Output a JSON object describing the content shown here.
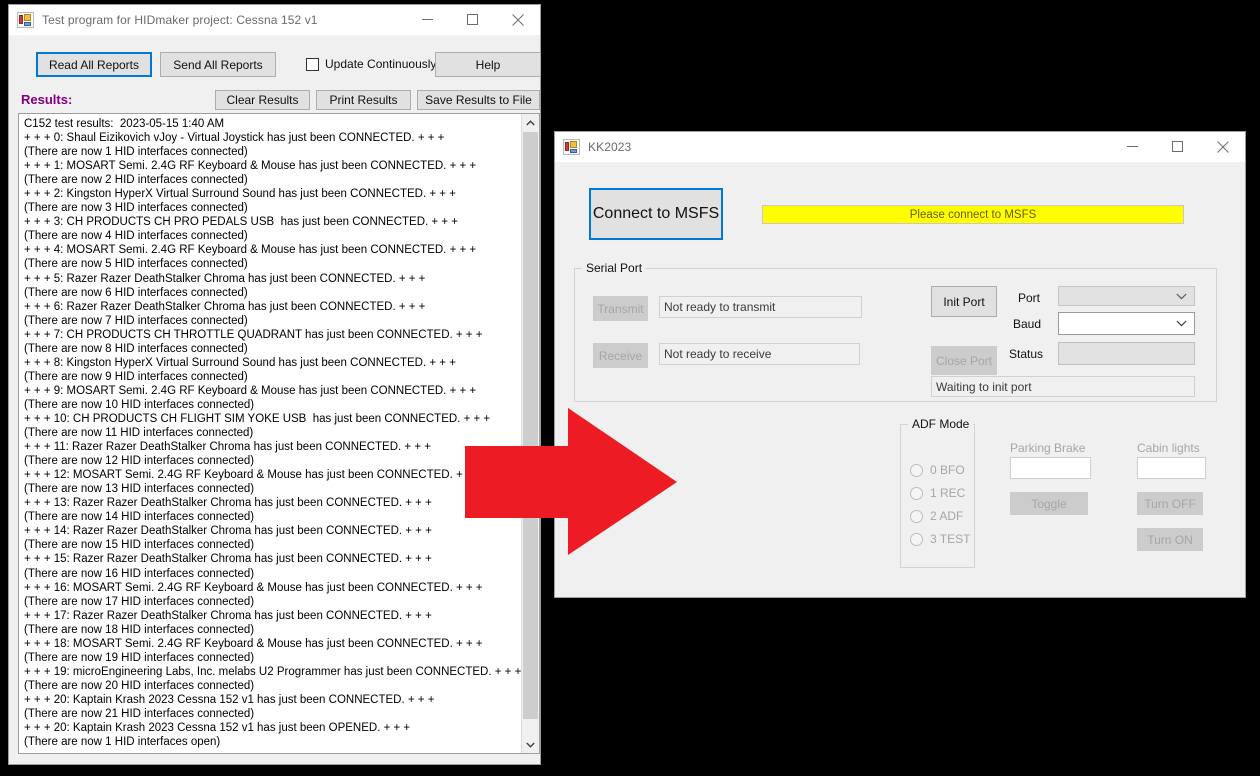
{
  "desktop": {
    "background_color": "#000000"
  },
  "hid_window": {
    "title": "Test program for HIDmaker project: Cessna 152 v1",
    "icon": "winforms-app-icon",
    "window_buttons": {
      "minimize": "minimize-icon",
      "maximize": "maximize-icon",
      "close": "close-icon"
    },
    "toolbar": {
      "read_all_reports": "Read All Reports",
      "send_all_reports": "Send All Reports",
      "update_continuously": "Update Continuously",
      "update_continuously_checked": false,
      "help": "Help"
    },
    "results_label": "Results:",
    "results_label_color": "#800080",
    "results_buttons": {
      "clear": "Clear Results",
      "print": "Print Results",
      "save": "Save Results to File"
    },
    "results_log": [
      "C152 test results:  2023-05-15 1:40 AM",
      "+ + + 0: Shaul Eizikovich vJoy - Virtual Joystick has just been CONNECTED. + + +",
      "(There are now 1 HID interfaces connected)",
      "+ + + 1: MOSART Semi. 2.4G RF Keyboard & Mouse has just been CONNECTED. + + +",
      "(There are now 2 HID interfaces connected)",
      "+ + + 2: Kingston HyperX Virtual Surround Sound has just been CONNECTED. + + +",
      "(There are now 3 HID interfaces connected)",
      "+ + + 3: CH PRODUCTS CH PRO PEDALS USB  has just been CONNECTED. + + +",
      "(There are now 4 HID interfaces connected)",
      "+ + + 4: MOSART Semi. 2.4G RF Keyboard & Mouse has just been CONNECTED. + + +",
      "(There are now 5 HID interfaces connected)",
      "+ + + 5: Razer Razer DeathStalker Chroma has just been CONNECTED. + + +",
      "(There are now 6 HID interfaces connected)",
      "+ + + 6: Razer Razer DeathStalker Chroma has just been CONNECTED. + + +",
      "(There are now 7 HID interfaces connected)",
      "+ + + 7: CH PRODUCTS CH THROTTLE QUADRANT has just been CONNECTED. + + +",
      "(There are now 8 HID interfaces connected)",
      "+ + + 8: Kingston HyperX Virtual Surround Sound has just been CONNECTED. + + +",
      "(There are now 9 HID interfaces connected)",
      "+ + + 9: MOSART Semi. 2.4G RF Keyboard & Mouse has just been CONNECTED. + + +",
      "(There are now 10 HID interfaces connected)",
      "+ + + 10: CH PRODUCTS CH FLIGHT SIM YOKE USB  has just been CONNECTED. + + +",
      "(There are now 11 HID interfaces connected)",
      "+ + + 11: Razer Razer DeathStalker Chroma has just been CONNECTED. + + +",
      "(There are now 12 HID interfaces connected)",
      "+ + + 12: MOSART Semi. 2.4G RF Keyboard & Mouse has just been CONNECTED. + + +",
      "(There are now 13 HID interfaces connected)",
      "+ + + 13: Razer Razer DeathStalker Chroma has just been CONNECTED. + + +",
      "(There are now 14 HID interfaces connected)",
      "+ + + 14: Razer Razer DeathStalker Chroma has just been CONNECTED. + + +",
      "(There are now 15 HID interfaces connected)",
      "+ + + 15: Razer Razer DeathStalker Chroma has just been CONNECTED. + + +",
      "(There are now 16 HID interfaces connected)",
      "+ + + 16: MOSART Semi. 2.4G RF Keyboard & Mouse has just been CONNECTED. + + +",
      "(There are now 17 HID interfaces connected)",
      "+ + + 17: Razer Razer DeathStalker Chroma has just been CONNECTED. + + +",
      "(There are now 18 HID interfaces connected)",
      "+ + + 18: MOSART Semi. 2.4G RF Keyboard & Mouse has just been CONNECTED. + + +",
      "(There are now 19 HID interfaces connected)",
      "+ + + 19: microEngineering Labs, Inc. melabs U2 Programmer has just been CONNECTED. + + +",
      "(There are now 20 HID interfaces connected)",
      "+ + + 20: Kaptain Krash 2023 Cessna 152 v1 has just been CONNECTED. + + +",
      "(There are now 21 HID interfaces connected)",
      "+ + + 20: Kaptain Krash 2023 Cessna 152 v1 has just been OPENED. + + +",
      "(There are now 1 HID interfaces open)"
    ],
    "scrollbar": {
      "up_arrow": "chevron-up-icon",
      "down_arrow": "chevron-down-icon"
    }
  },
  "kk_window": {
    "title": "KK2023",
    "icon": "winforms-app-icon",
    "window_buttons": {
      "minimize": "minimize-icon",
      "maximize": "maximize-icon",
      "close": "close-icon"
    },
    "connect_button": "Connect to MSFS",
    "status_banner": {
      "text": "Please connect to MSFS",
      "background_color": "#ffff00",
      "text_color": "#6b5a00"
    },
    "serial_port": {
      "group_title": "Serial Port",
      "transmit_button": "Transmit",
      "transmit_status": "Not ready to transmit",
      "receive_button": "Receive",
      "receive_status": "Not ready to receive",
      "init_port_button": "Init Port",
      "close_port_button": "Close Port",
      "port_label": "Port",
      "port_value": "",
      "baud_label": "Baud",
      "baud_value": "",
      "status_label": "Status",
      "status_value": "",
      "init_status": "Waiting to init port"
    },
    "adf_mode": {
      "group_title": "ADF Mode",
      "options": [
        "0 BFO",
        "1 REC",
        "2 ADF",
        "3 TEST"
      ],
      "selected": null
    },
    "parking_brake": {
      "label": "Parking Brake",
      "value": "",
      "toggle_button": "Toggle"
    },
    "cabin_lights": {
      "label": "Cabin lights",
      "value": "",
      "turn_off_button": "Turn OFF",
      "turn_on_button": "Turn ON"
    }
  },
  "annotation_arrow": {
    "name": "red-right-arrow",
    "color": "#ED1C24",
    "direction": "right"
  }
}
